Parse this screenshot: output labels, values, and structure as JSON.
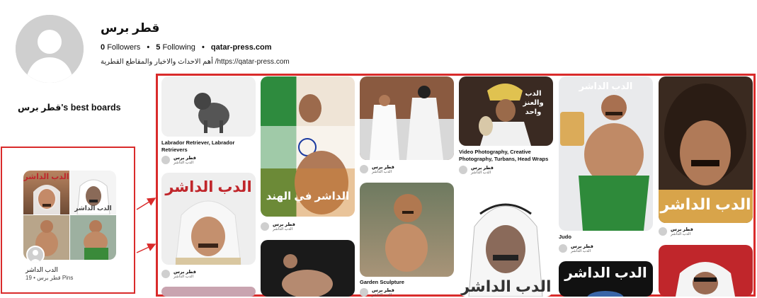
{
  "profile": {
    "name": "قطر برس",
    "followers_count": "0",
    "followers_label": "Followers",
    "following_count": "5",
    "following_label": "Following",
    "website": "qatar-press.com",
    "bio": "أهم الاحداث والاخبار والمقاطع القطرية /https://qatar-press.com"
  },
  "boards_section": {
    "title": "قطر برس's best boards"
  },
  "board": {
    "cover_texts": [
      "الدب الداشر",
      "الدب الداشر"
    ],
    "title": "الدب الداشر",
    "meta": "19 • قطر برس Pins"
  },
  "pins": [
    {
      "id": "p1",
      "title": "Labrador Retriever, Labrador Retrievers",
      "user": "قطر برس",
      "board": "الدب الداشر"
    },
    {
      "id": "p2",
      "overlay": "الدب الداشر",
      "user": "قطر برس",
      "board": "الدب الداشر"
    },
    {
      "id": "p3",
      "overlay": "الداشر في الهند",
      "user": "قطر برس",
      "board": "الدب الداشر"
    },
    {
      "id": "p4",
      "user": "قطر برس",
      "board": "الدب الداشر"
    },
    {
      "id": "p5",
      "title": "Garden Sculpture",
      "user": "قطر برس",
      "board": "الدب الداشر"
    },
    {
      "id": "p6",
      "overlay": "الدب والعنز واحد",
      "title": "Video Photography, Creative Photography, Turbans, Head Wraps",
      "user": "قطر برس",
      "board": "الدب الداشر"
    },
    {
      "id": "p7",
      "overlay": "الدب الداشر"
    },
    {
      "id": "p8",
      "overlay": "الدب الداشر",
      "title": "Judo",
      "user": "قطر برس",
      "board": "الدب الداشر"
    },
    {
      "id": "p9",
      "overlay": "الدب الداشر"
    },
    {
      "id": "p10",
      "overlay": "الدب الداشر",
      "user": "قطر برس",
      "board": "الدب الداشر"
    }
  ],
  "colors": {
    "highlight": "#d92b2b",
    "overlay_red": "#c0262b"
  }
}
